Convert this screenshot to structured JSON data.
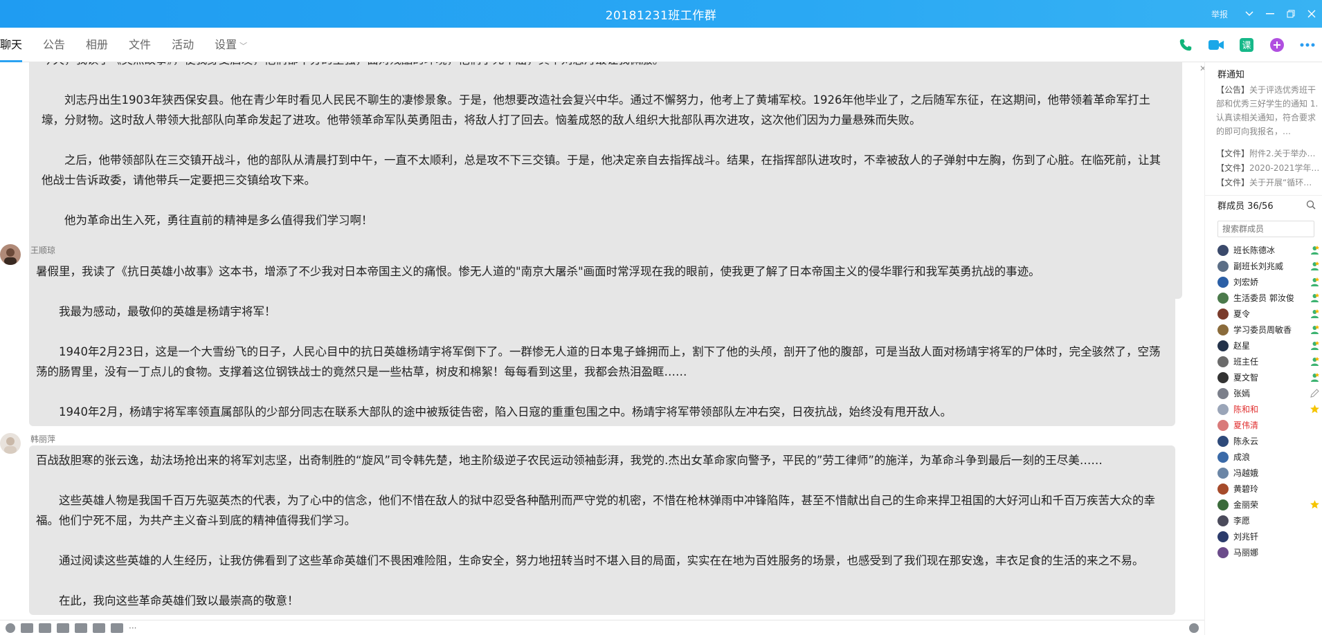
{
  "window": {
    "title": "20181231班工作群",
    "report_label": "举报"
  },
  "tabs": [
    {
      "label": "聊天",
      "active": true
    },
    {
      "label": "公告"
    },
    {
      "label": "相册"
    },
    {
      "label": "文件"
    },
    {
      "label": "活动"
    },
    {
      "label": "设置"
    }
  ],
  "toolbar_icons": [
    "phone-icon",
    "video-icon",
    "course-icon",
    "add-app-icon",
    "more-icon"
  ],
  "messages": [
    {
      "paragraphs": [
        {
          "text": "今天，我读了《英烈故事》，使我身受启发，他们都十分的坚强，面对残酷的环境，他们宁死不屈，其中刘志丹最让我佩服。",
          "indent": false
        },
        {
          "text": "刘志丹出生1903年狭西保安县。他在青少年时看见人民民不聊生的凄惨景象。于是，他想要改造社会复兴中华。通过不懈努力，他考上了黄埔军校。1926年他毕业了，之后随军东征，在这期间，他带领着革命军打土壕，分财物。这时敌人带领大批部队向革命发起了进攻。他带领革命军队英勇阻击，将敌人打了回去。恼羞成怒的敌人组织大批部队再次进攻，这次他们因为力量悬殊而失败。",
          "indent": true
        },
        {
          "text": "之后，他带领部队在三交镇开战斗，他的部队从清晨打到中午，一直不太顺利，总是攻不下三交镇。于是，他决定亲自去指挥战斗。结果，在指挥部队进攻时，不幸被敌人的子弹射中左胸，伤到了心脏。在临死前，让其他战士告诉政委，请他带兵一定要把三交镇给攻下来。",
          "indent": true
        },
        {
          "text": "他为革命出生入死，勇往直前的精神是多么值得我们学习啊！",
          "indent": true
        }
      ]
    },
    {
      "sender": "王顺琼",
      "paragraphs": [
        {
          "text": "暑假里，我读了《抗日英雄小故事》这本书，增添了不少我对日本帝国主义的痛恨。惨无人道的\"南京大屠杀\"画面时常浮现在我的眼前，使我更了解了日本帝国主义的侵华罪行和我军英勇抗战的事迹。",
          "indent": false
        },
        {
          "text": "我最为感动，最敬仰的英雄是杨靖宇将军！",
          "indent": true
        },
        {
          "text": "1940年2月23日，这是一个大雪纷飞的日子，人民心目中的抗日英雄杨靖宇将军倒下了。一群惨无人道的日本鬼子蜂拥而上，割下了他的头颅，剖开了他的腹部，可是当敌人面对杨靖宇将军的尸体时，完全骇然了，空荡荡的肠胃里，没有一丁点儿的食物。支撑着这位钢铁战士的竟然只是一些枯草，树皮和棉絮！每每看到这里，我都会热泪盈眶……",
          "indent": true
        },
        {
          "text": "1940年2月，杨靖宇将军率领直属部队的少部分同志在联系大部队的途中被叛徒告密，陷入日寇的重重包围之中。杨靖宇将军带领部队左冲右突，日夜抗战，始终没有甩开敌人。",
          "indent": true
        }
      ]
    },
    {
      "sender": "韩丽萍",
      "paragraphs": [
        {
          "text": "百战敌胆寒的张云逸，劫法场抢出来的将军刘志坚，出奇制胜的“旋风”司令韩先楚，地主阶级逆子农民运动领袖彭湃，我党的.杰出女革命家向警予，平民的”劳工律师”的施洋，为革命斗争到最后一刻的王尽美……",
          "indent": false
        },
        {
          "text": "这些英雄人物是我国千百万先驱英杰的代表，为了心中的信念，他们不惜在敌人的狱中忍受各种酷刑而严守党的机密，不惜在枪林弹雨中冲锋陷阵，甚至不惜献出自己的生命来捍卫祖国的大好河山和千百万疾苦大众的幸福。他们宁死不屈，为共产主义奋斗到底的精神值得我们学习。",
          "indent": true
        },
        {
          "text": "通过阅读这些英雄的人生经历，让我仿佛看到了这些革命英雄们不畏困难险阻，生命安全，努力地扭转当时不堪入目的局面，实实在在地为百姓服务的场景，也感受到了我们现在那安逸，丰衣足食的生活的来之不易。",
          "indent": true
        },
        {
          "text": "在此，我向这些革命英雄们致以最崇高的敬意！",
          "indent": true
        }
      ]
    }
  ],
  "notice": {
    "title": "群通知",
    "announcement_tag": "【公告】",
    "announcement_text": "关于评选优秀班干部和优秀三好学生的通知 1.认真读相关通知，符合要求的即可向我报名，…",
    "files": [
      {
        "tag": "【文件】",
        "text": "附件2.关于举办…"
      },
      {
        "tag": "【文件】",
        "text": "2020-2021学年…"
      },
      {
        "tag": "【文件】",
        "text": "关于开展“循环…"
      }
    ]
  },
  "members": {
    "title": "群成员 36/56",
    "search_placeholder": "搜索群成员",
    "list": [
      {
        "name": "班长陈德冰",
        "badge": "admin",
        "color": "#3b4a6b"
      },
      {
        "name": "副班长刘兆威",
        "badge": "admin",
        "color": "#5b6e86"
      },
      {
        "name": "刘宏娇",
        "badge": "admin",
        "color": "#2b5fa6"
      },
      {
        "name": "生活委员 郭汝俊",
        "badge": "admin",
        "color": "#4b7a4b"
      },
      {
        "name": "夏令",
        "badge": "admin",
        "color": "#7a3b2b"
      },
      {
        "name": "学习委员周敏香",
        "badge": "admin",
        "color": "#8a6b3b"
      },
      {
        "name": "赵星",
        "badge": "admin",
        "color": "#23324a"
      },
      {
        "name": "班主任",
        "badge": "admin",
        "color": "#6b6b6b"
      },
      {
        "name": "夏文智",
        "badge": "admin",
        "color": "#333333"
      },
      {
        "name": "张嫣",
        "badge": "edit",
        "color": "#7b7f8a"
      },
      {
        "name": "陈和和",
        "badge": "star",
        "color": "#9aa5b8",
        "red": true
      },
      {
        "name": "夏伟清",
        "badge": "",
        "color": "#d97a7a",
        "red": true
      },
      {
        "name": "陈永云",
        "badge": "",
        "color": "#2e4a7a"
      },
      {
        "name": "成浪",
        "badge": "",
        "color": "#3a6aa8"
      },
      {
        "name": "冯越娥",
        "badge": "",
        "color": "#6b86a6"
      },
      {
        "name": "黄碧玲",
        "badge": "",
        "color": "#a64b2b"
      },
      {
        "name": "金丽荣",
        "badge": "star",
        "color": "#3b6b3b"
      },
      {
        "name": "李愿",
        "badge": "",
        "color": "#4b4b5b"
      },
      {
        "name": "刘兆钎",
        "badge": "",
        "color": "#2b3b6b"
      },
      {
        "name": "马丽娜",
        "badge": "",
        "color": "#6b4b8a"
      }
    ]
  }
}
